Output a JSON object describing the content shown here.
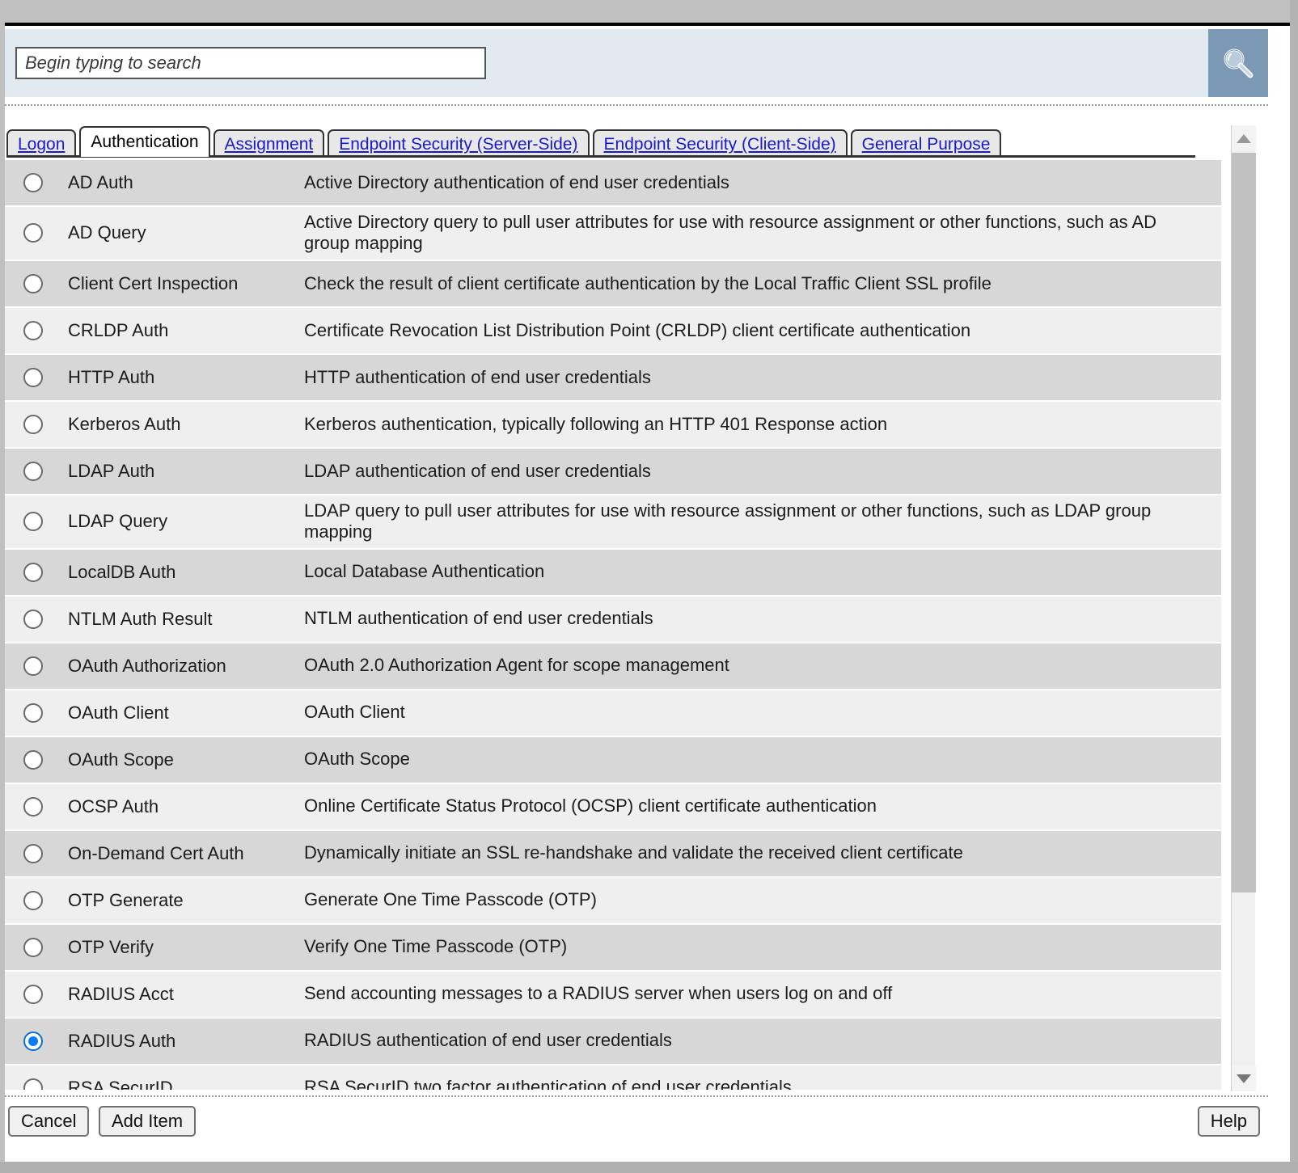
{
  "search": {
    "placeholder": "Begin typing to search",
    "value": "",
    "button_icon": "search-icon"
  },
  "tabs": [
    {
      "label": "Logon",
      "active": false
    },
    {
      "label": "Authentication",
      "active": true
    },
    {
      "label": "Assignment",
      "active": false
    },
    {
      "label": "Endpoint Security (Server-Side)",
      "active": false
    },
    {
      "label": "Endpoint Security (Client-Side)",
      "active": false
    },
    {
      "label": "General Purpose",
      "active": false
    }
  ],
  "selected_item": "RADIUS Auth",
  "items": [
    {
      "name": "AD Auth",
      "description": "Active Directory authentication of end user credentials",
      "selected": false
    },
    {
      "name": "AD Query",
      "description": "Active Directory query to pull user attributes for use with resource assignment or other functions, such as AD group mapping",
      "selected": false
    },
    {
      "name": "Client Cert Inspection",
      "description": "Check the result of client certificate authentication by the Local Traffic Client SSL profile",
      "selected": false
    },
    {
      "name": "CRLDP Auth",
      "description": "Certificate Revocation List Distribution Point (CRLDP) client certificate authentication",
      "selected": false
    },
    {
      "name": "HTTP Auth",
      "description": "HTTP authentication of end user credentials",
      "selected": false
    },
    {
      "name": "Kerberos Auth",
      "description": "Kerberos authentication, typically following an HTTP 401 Response action",
      "selected": false
    },
    {
      "name": "LDAP Auth",
      "description": "LDAP authentication of end user credentials",
      "selected": false
    },
    {
      "name": "LDAP Query",
      "description": "LDAP query to pull user attributes for use with resource assignment or other functions, such as LDAP group mapping",
      "selected": false
    },
    {
      "name": "LocalDB Auth",
      "description": "Local Database Authentication",
      "selected": false
    },
    {
      "name": "NTLM Auth Result",
      "description": "NTLM authentication of end user credentials",
      "selected": false
    },
    {
      "name": "OAuth Authorization",
      "description": "OAuth 2.0 Authorization Agent for scope management",
      "selected": false
    },
    {
      "name": "OAuth Client",
      "description": "OAuth Client",
      "selected": false
    },
    {
      "name": "OAuth Scope",
      "description": "OAuth Scope",
      "selected": false
    },
    {
      "name": "OCSP Auth",
      "description": "Online Certificate Status Protocol (OCSP) client certificate authentication",
      "selected": false
    },
    {
      "name": "On-Demand Cert Auth",
      "description": "Dynamically initiate an SSL re-handshake and validate the received client certificate",
      "selected": false
    },
    {
      "name": "OTP Generate",
      "description": "Generate One Time Passcode (OTP)",
      "selected": false
    },
    {
      "name": "OTP Verify",
      "description": "Verify One Time Passcode (OTP)",
      "selected": false
    },
    {
      "name": "RADIUS Acct",
      "description": "Send accounting messages to a RADIUS server when users log on and off",
      "selected": false
    },
    {
      "name": "RADIUS Auth",
      "description": "RADIUS authentication of end user credentials",
      "selected": true
    },
    {
      "name": "RSA SecurID",
      "description": "RSA SecurID two factor authentication of end user credentials",
      "selected": false
    }
  ],
  "scrollbar": {
    "up_icon": "triangle-up-icon",
    "down_icon": "triangle-down-icon"
  },
  "buttons": {
    "cancel": "Cancel",
    "add_item": "Add Item",
    "help": "Help"
  },
  "colors": {
    "accent": "#0a7cf5",
    "search_bar_bg": "#e2eaf1",
    "search_button_bg": "#7b98b5",
    "tab_link": "#1a1acd",
    "row_odd": "#d7d7d7",
    "row_even": "#efefef"
  }
}
